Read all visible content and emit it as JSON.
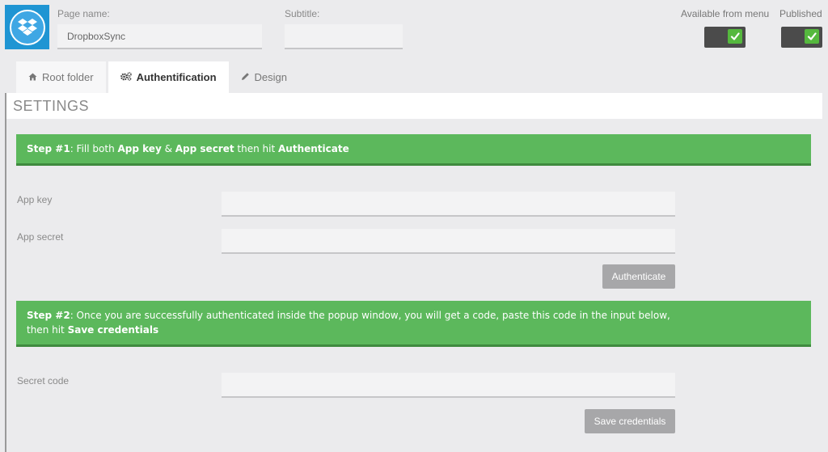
{
  "header": {
    "icon_name": "dropbox-icon",
    "page_name_label": "Page name:",
    "page_name_value": "DropboxSync",
    "subtitle_label": "Subtitle:",
    "subtitle_value": "",
    "available_from_menu_label": "Available from menu",
    "available_from_menu_checked": true,
    "published_label": "Published",
    "published_checked": true
  },
  "tabs": [
    {
      "label": "Root folder",
      "icon": "home-icon"
    },
    {
      "label": "Authentification",
      "icon": "gears-icon"
    },
    {
      "label": "Design",
      "icon": "pencil-icon"
    }
  ],
  "settings": {
    "title": "SETTINGS",
    "step1": {
      "prefix": "Step #1",
      "text_a": ": Fill both ",
      "app_key": "App key",
      "text_b": " & ",
      "app_secret": "App secret",
      "text_c": " then hit ",
      "authenticate": "Authenticate"
    },
    "app_key_label": "App key",
    "app_secret_label": "App secret",
    "authenticate_button": "Authenticate",
    "step2": {
      "prefix": "Step #2",
      "text_a": ": Once you are successfully authenticated inside the popup window, you will get a code, paste this code in the input below,",
      "text_b": "then hit ",
      "save": "Save credentials"
    },
    "secret_code_label": "Secret code",
    "save_button": "Save credentials"
  },
  "colors": {
    "accent_green": "#5cb85c",
    "brand_blue": "#1f95d3",
    "toggle_check": "#55b83e"
  }
}
